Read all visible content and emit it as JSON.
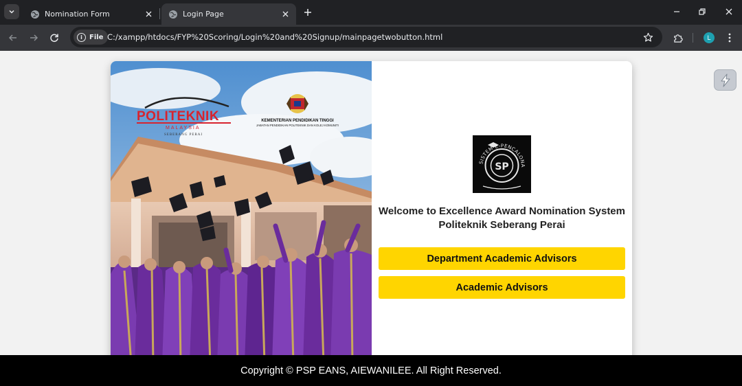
{
  "browser": {
    "tabs": [
      {
        "title": "Nomination Form",
        "active": false
      },
      {
        "title": "Login Page",
        "active": true
      }
    ],
    "address_chip": "File",
    "url": "C:/xampp/htdocs/FYP%20Scoring/Login%20and%20Signup/mainpagetwobutton.html",
    "profile_initial": "L"
  },
  "page": {
    "hero": {
      "logo_politeknik": "POLITEKNIK MALAYSIA SEBERANG PERAI",
      "logo_kementerian": "KEMENTERIAN PENDIDIKAN TINGGI JABATAN PENDIDIKAN POLITEKNIK DAN KOLEJ KOMUNITI"
    },
    "system_logo_text": "SISTEM E-PENCALONAN SP",
    "welcome_line1": "Welcome to Excellence Award Nomination System",
    "welcome_line2": "Politeknik Seberang Perai",
    "buttons": {
      "department": "Department Academic Advisors",
      "academic": "Academic Advisors"
    },
    "footer": "Copyright © PSP EANS, AIEWANILEE. All Right Reserved."
  },
  "colors": {
    "button_bg": "#ffd500",
    "footer_bg": "#000000",
    "robe_purple": "#6a2c9c"
  }
}
